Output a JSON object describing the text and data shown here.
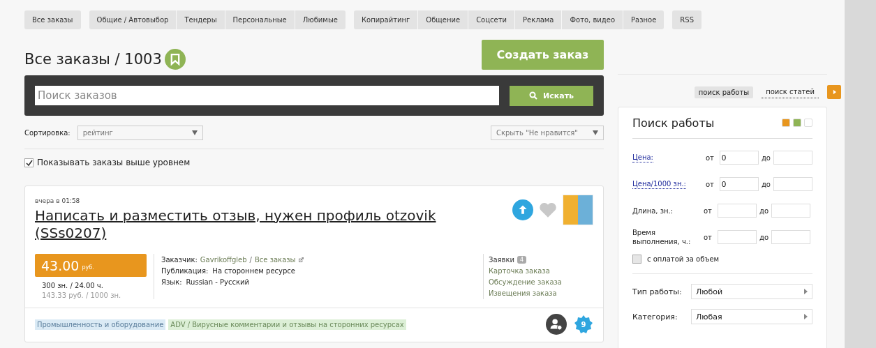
{
  "tab_groups": [
    [
      {
        "label": "Все заказы",
        "selected": false
      }
    ],
    [
      {
        "label": "Общие / Автовыбор",
        "selected": false
      },
      {
        "label": "Тендеры",
        "selected": false
      },
      {
        "label": "Персональные",
        "selected": false
      },
      {
        "label": "Любимые",
        "selected": false
      }
    ],
    [
      {
        "label": "Копирайтинг",
        "selected": false
      },
      {
        "label": "Общение",
        "selected": false
      },
      {
        "label": "Соцсети",
        "selected": false
      },
      {
        "label": "Реклама",
        "selected": false
      },
      {
        "label": "Фото, видео",
        "selected": false
      },
      {
        "label": "Разное",
        "selected": false
      }
    ],
    [
      {
        "label": "RSS",
        "selected": false
      }
    ]
  ],
  "page_title": "Все заказы / 1003",
  "create_button": "Создать заказ",
  "search": {
    "placeholder": "Поиск заказов",
    "button": "Искать"
  },
  "sort": {
    "label": "Сортировка:",
    "value": "рейтинг"
  },
  "hide_filter": {
    "value": "Скрыть \"Не нравится\""
  },
  "show_higher": {
    "label": "Показывать заказы выше уровнем",
    "checked": true
  },
  "order": {
    "time": "вчера в 01:58",
    "title": "Написать и разместить отзыв, нужен профиль otzovik (SSs0207)",
    "price": "43.00",
    "currency": "руб.",
    "volume": "300 зн. / 24.00 ч.",
    "rate": "143.33 руб. / 1000 зн.",
    "meta": [
      {
        "label": "Заказчик:",
        "value": "Gavrikoffgleb",
        "separator": "/",
        "extra": "Все заказы"
      },
      {
        "label": "Публикация:",
        "value": "На стороннем ресурсе"
      },
      {
        "label": "Язык:",
        "value": "Russian - Русский"
      }
    ],
    "bids": {
      "label": "Заявки",
      "count": "4"
    },
    "links": [
      "Карточка заказа",
      "Обсуждение заказа",
      "Извещения заказа"
    ],
    "favorite": false,
    "tags": [
      {
        "label": "Промышленность и оборудование",
        "color": "#daeaf5"
      },
      {
        "label": "ADV / Вирусные комментарии и отзывы на сторонних ресурсах",
        "color": "#dcefd6"
      }
    ],
    "level_badge": "9"
  },
  "sidebar": {
    "switch": [
      {
        "label": "поиск работы",
        "selected": true
      },
      {
        "label": "поиск статей",
        "selected": false
      }
    ],
    "title": "Поиск работы",
    "themes": [
      {
        "color": "#e8961e",
        "selected": false
      },
      {
        "color": "#8fb455",
        "selected": false
      },
      {
        "color": "#ffffff",
        "selected": false
      }
    ],
    "ranges": [
      {
        "label": "Цена:",
        "link": true,
        "from": "от",
        "from_value": "0",
        "to": "до"
      },
      {
        "label": "Цена/1000 зн.:",
        "link": true,
        "from": "от",
        "from_value": "0",
        "to": "до"
      },
      {
        "label": "Длина, зн.:",
        "link": false,
        "from": "от",
        "to": "до"
      },
      {
        "label": "Время выполнения, ч.:",
        "link": false,
        "from": "от",
        "to": "до"
      }
    ],
    "volume_pay": {
      "label": "с оплатой за объем",
      "checked": false
    },
    "selects": [
      {
        "label": "Тип работы:",
        "value": "Любой"
      },
      {
        "label": "Категория:",
        "value": "Любая"
      }
    ]
  }
}
